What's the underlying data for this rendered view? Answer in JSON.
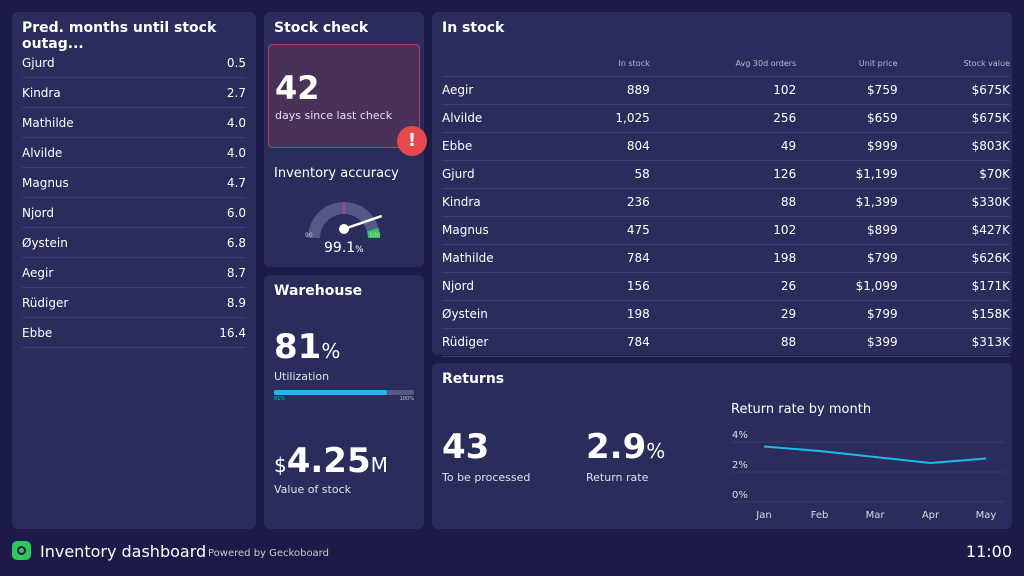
{
  "outage": {
    "title": "Pred. months until stock outag...",
    "rows": [
      [
        "Gjurd",
        "0.5"
      ],
      [
        "Kindra",
        "2.7"
      ],
      [
        "Mathilde",
        "4.0"
      ],
      [
        "Alvilde",
        "4.0"
      ],
      [
        "Magnus",
        "4.7"
      ],
      [
        "Njord",
        "6.0"
      ],
      [
        "Øystein",
        "6.8"
      ],
      [
        "Aegir",
        "8.7"
      ],
      [
        "Rüdiger",
        "8.9"
      ],
      [
        "Ebbe",
        "16.4"
      ]
    ]
  },
  "stock_check": {
    "title": "Stock check",
    "value": "42",
    "label": "days since last check",
    "alert_icon": "!",
    "alert_color": "#e5484d"
  },
  "accuracy": {
    "title": "Inventory accuracy",
    "value": "99.1",
    "unit": "%",
    "min": "90",
    "max": "100",
    "value_num": 99.1
  },
  "warehouse": {
    "title": "Warehouse",
    "utilization": "81",
    "unit": "%",
    "utilization_label": "Utilization",
    "bar_min": "81%",
    "bar_max": "100%",
    "utilization_fraction": 0.81,
    "stock_value_prefix": "$",
    "stock_value": "4.25",
    "stock_value_suffix": "M",
    "stock_value_label": "Value of stock"
  },
  "instock": {
    "title": "In stock",
    "headers": [
      "",
      "In stock",
      "Avg 30d orders",
      "Unit price",
      "Stock value"
    ],
    "rows": [
      [
        "Aegir",
        "889",
        "102",
        "$759",
        "$675K"
      ],
      [
        "Alvilde",
        "1,025",
        "256",
        "$659",
        "$675K"
      ],
      [
        "Ebbe",
        "804",
        "49",
        "$999",
        "$803K"
      ],
      [
        "Gjurd",
        "58",
        "126",
        "$1,199",
        "$70K"
      ],
      [
        "Kindra",
        "236",
        "88",
        "$1,399",
        "$330K"
      ],
      [
        "Magnus",
        "475",
        "102",
        "$899",
        "$427K"
      ],
      [
        "Mathilde",
        "784",
        "198",
        "$799",
        "$626K"
      ],
      [
        "Njord",
        "156",
        "26",
        "$1,099",
        "$171K"
      ],
      [
        "Øystein",
        "198",
        "29",
        "$799",
        "$158K"
      ],
      [
        "Rüdiger",
        "784",
        "88",
        "$399",
        "$313K"
      ]
    ]
  },
  "returns": {
    "title": "Returns",
    "processed": "43",
    "processed_label": "To be processed",
    "rate": "2.9",
    "rate_unit": "%",
    "rate_label": "Return rate"
  },
  "chart_data": {
    "type": "line",
    "title": "Return rate by month",
    "categories": [
      "Jan",
      "Feb",
      "Mar",
      "Apr",
      "May"
    ],
    "values": [
      3.7,
      3.4,
      3.0,
      2.6,
      2.9
    ],
    "yticks": [
      "0%",
      "2%",
      "4%"
    ],
    "ylim": [
      0,
      4
    ],
    "grid": true,
    "color": "#1fb8ea"
  },
  "footer": {
    "title": "Inventory dashboard",
    "powered": "Powered by Geckoboard",
    "time": "11:00"
  }
}
